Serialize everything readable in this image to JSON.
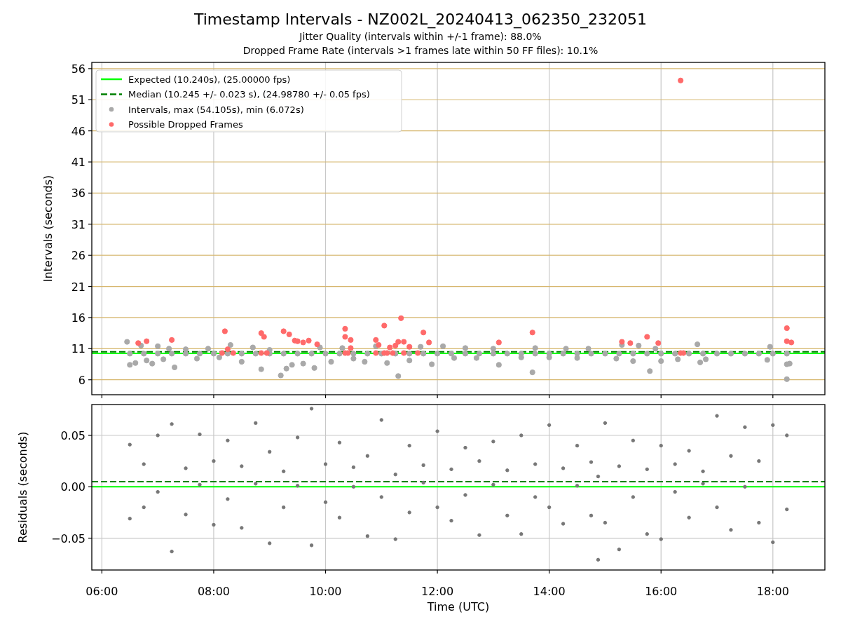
{
  "figure": {
    "title": "Timestamp Intervals - NZ002L_20240413_062350_232051",
    "subtitles": [
      "Jitter Quality (intervals within +/-1 frame): 88.0%",
      "Dropped Frame Rate (intervals >1 frames late within 50 FF files): 10.1%"
    ]
  },
  "panels": [
    {
      "chart_data": {
        "type": "scatter",
        "ylabel": "Intervals (seconds)",
        "xlim": [
          5.82,
          18.93
        ],
        "ylim": [
          3.6,
          57
        ],
        "legend": true,
        "grid": true,
        "yticks": [
          {
            "value": 6,
            "label": "6"
          },
          {
            "value": 11,
            "label": "11"
          },
          {
            "value": 16,
            "label": "16"
          },
          {
            "value": 21,
            "label": "21"
          },
          {
            "value": 26,
            "label": "26"
          },
          {
            "value": 31,
            "label": "31"
          },
          {
            "value": 36,
            "label": "36"
          },
          {
            "value": 41,
            "label": "41"
          },
          {
            "value": 46,
            "label": "46"
          },
          {
            "value": 51,
            "label": "51"
          },
          {
            "value": 56,
            "label": "56"
          }
        ],
        "series": [
          {
            "type": "line",
            "name": "Expected (10.240s), (25.00000 fps)",
            "color": "#00ff00",
            "x": [
              5.82,
              18.93
            ],
            "values": [
              10.24,
              10.24
            ]
          },
          {
            "type": "line",
            "name": "Median (10.245 +/- 0.023 s), (24.98780 +/- 0.05 fps)",
            "color": "#008000",
            "line_style": "dashed",
            "x": [
              5.82,
              18.93
            ],
            "values": [
              10.5,
              10.5
            ]
          },
          {
            "type": "scatter",
            "name": "Intervals, max (54.105s), min (6.072s)",
            "color": "#a9a9a9",
            "x": [
              6.5,
              6.75,
              7.0,
              7.25,
              7.5,
              7.75,
              8.0,
              8.25,
              8.5,
              8.75,
              9.0,
              9.25,
              9.5,
              9.75,
              10.0,
              10.25,
              10.5,
              10.75,
              11.0,
              11.25,
              11.5,
              11.75,
              12.0,
              12.25,
              12.5,
              12.75,
              13.0,
              13.25,
              13.5,
              13.75,
              14.0,
              14.25,
              14.5,
              14.75,
              15.0,
              15.25,
              15.5,
              15.75,
              16.0,
              16.25,
              16.5,
              16.75,
              17.0,
              17.25,
              17.5,
              17.75,
              18.0,
              18.25,
              6.45,
              6.5,
              6.6,
              6.7,
              6.8,
              6.9,
              7.0,
              7.1,
              7.2,
              7.3,
              7.5,
              7.7,
              7.9,
              8.1,
              8.3,
              8.5,
              8.7,
              8.85,
              9.0,
              9.2,
              9.3,
              9.4,
              9.6,
              9.8,
              9.9,
              10.1,
              10.3,
              10.5,
              10.7,
              10.9,
              11.1,
              11.3,
              11.5,
              11.7,
              11.9,
              12.1,
              12.3,
              12.5,
              12.7,
              13.0,
              13.1,
              13.5,
              13.7,
              13.75,
              14.0,
              14.3,
              14.5,
              14.7,
              15.2,
              15.3,
              15.5,
              15.6,
              15.8,
              15.9,
              16.0,
              16.3,
              16.65,
              16.7,
              16.8,
              17.9,
              17.95,
              18.25,
              18.25,
              18.3
            ],
            "values": [
              10.2,
              10.2,
              10.2,
              10.2,
              10.2,
              10.2,
              10.2,
              10.2,
              10.2,
              10.2,
              10.2,
              10.2,
              10.2,
              10.2,
              10.2,
              10.2,
              10.2,
              10.2,
              10.2,
              10.2,
              10.2,
              10.2,
              10.2,
              10.2,
              10.2,
              10.2,
              10.2,
              10.2,
              10.2,
              10.2,
              10.2,
              10.2,
              10.2,
              10.2,
              10.2,
              10.2,
              10.2,
              10.2,
              10.2,
              10.2,
              10.2,
              10.2,
              10.2,
              10.2,
              10.2,
              10.2,
              10.2,
              10.2,
              12.1,
              8.4,
              8.7,
              11.5,
              9.1,
              8.6,
              11.4,
              9.3,
              11.0,
              8.0,
              10.9,
              9.4,
              11.0,
              9.6,
              11.6,
              8.9,
              11.2,
              7.7,
              10.8,
              6.7,
              7.8,
              8.4,
              8.6,
              7.9,
              11.2,
              8.9,
              11.1,
              9.4,
              8.9,
              11.4,
              8.7,
              6.6,
              9.1,
              11.3,
              8.5,
              11.4,
              9.5,
              11.1,
              9.5,
              11.0,
              8.4,
              9.6,
              7.2,
              11.1,
              9.6,
              11.0,
              9.5,
              11.0,
              9.4,
              11.6,
              9.0,
              11.5,
              7.4,
              11.0,
              9.0,
              9.3,
              11.7,
              8.8,
              9.3,
              9.2,
              11.3,
              6.1,
              8.5,
              8.6
            ]
          },
          {
            "type": "scatter",
            "name": "Possible Dropped Frames",
            "color": "#ff6a6a",
            "x": [
              6.65,
              6.8,
              7.25,
              8.2,
              8.25,
              8.85,
              8.9,
              9.25,
              9.35,
              9.45,
              9.5,
              9.6,
              9.7,
              9.85,
              10.35,
              10.35,
              10.45,
              10.45,
              10.9,
              10.95,
              11.05,
              11.15,
              11.25,
              11.3,
              11.35,
              11.4,
              11.5,
              11.75,
              11.85,
              13.1,
              13.7,
              15.3,
              15.45,
              15.75,
              15.95,
              16.35,
              18.25,
              18.25,
              18.33,
              8.15,
              8.35,
              8.85,
              8.95,
              10.35,
              10.4,
              10.9,
              11.05,
              11.1,
              11.2,
              11.4,
              11.65,
              16.35,
              16.4
            ],
            "values": [
              11.9,
              12.2,
              12.4,
              13.8,
              10.9,
              13.5,
              12.9,
              13.8,
              13.3,
              12.3,
              12.2,
              12.0,
              12.3,
              11.7,
              14.2,
              12.9,
              12.4,
              11.1,
              12.4,
              11.6,
              14.7,
              11.2,
              11.5,
              12.1,
              15.9,
              12.1,
              11.3,
              13.6,
              12.0,
              12.0,
              13.6,
              12.1,
              11.9,
              12.9,
              11.9,
              54.1,
              14.3,
              12.2,
              12.0,
              10.3,
              10.3,
              10.3,
              10.3,
              10.3,
              10.3,
              10.3,
              10.3,
              10.3,
              10.3,
              10.3,
              10.3,
              10.3,
              10.3
            ]
          }
        ]
      }
    },
    {
      "chart_data": {
        "type": "scatter",
        "xlabel": "Time (UTC)",
        "ylabel": "Residuals (seconds)",
        "xlim": [
          5.82,
          18.93
        ],
        "ylim": [
          -0.081,
          0.08
        ],
        "legend": false,
        "grid": true,
        "xticks": [
          {
            "value": 6,
            "label": "06:00"
          },
          {
            "value": 8,
            "label": "08:00"
          },
          {
            "value": 10,
            "label": "10:00"
          },
          {
            "value": 12,
            "label": "12:00"
          },
          {
            "value": 14,
            "label": "14:00"
          },
          {
            "value": 16,
            "label": "16:00"
          },
          {
            "value": 18,
            "label": "18:00"
          }
        ],
        "yticks": [
          {
            "value": -0.05,
            "label": "−0.05"
          },
          {
            "value": 0,
            "label": "0.00"
          },
          {
            "value": 0.05,
            "label": "0.05"
          }
        ],
        "series": [
          {
            "type": "line",
            "color": "#00ff00",
            "x": [
              5.82,
              18.93
            ],
            "values": [
              0,
              0
            ]
          },
          {
            "type": "line",
            "color": "#008000",
            "line_style": "dashed",
            "x": [
              5.82,
              18.93
            ],
            "values": [
              0.005,
              0.005
            ]
          },
          {
            "type": "scatter",
            "color": "#777777",
            "x": [
              6.5,
              6.5,
              6.75,
              6.75,
              7.0,
              7.0,
              7.25,
              7.25,
              7.5,
              7.5,
              7.75,
              7.75,
              8.0,
              8.0,
              8.25,
              8.25,
              8.5,
              8.5,
              8.75,
              8.75,
              9.0,
              9.0,
              9.25,
              9.25,
              9.5,
              9.5,
              9.75,
              9.75,
              10.0,
              10.0,
              10.25,
              10.25,
              10.5,
              10.5,
              10.75,
              10.75,
              11.0,
              11.0,
              11.25,
              11.25,
              11.5,
              11.5,
              11.75,
              11.75,
              12.0,
              12.0,
              12.25,
              12.25,
              12.5,
              12.5,
              12.75,
              12.75,
              13.0,
              13.0,
              13.25,
              13.25,
              13.5,
              13.5,
              13.75,
              13.75,
              14.0,
              14.0,
              14.25,
              14.25,
              14.5,
              14.5,
              14.75,
              14.75,
              14.875,
              14.875,
              15.0,
              15.0,
              15.25,
              15.25,
              15.5,
              15.5,
              15.75,
              15.75,
              16.0,
              16.0,
              16.25,
              16.25,
              16.5,
              16.5,
              16.75,
              16.75,
              17.0,
              17.0,
              17.25,
              17.25,
              17.5,
              17.5,
              17.75,
              17.75,
              18.0,
              18.0,
              18.25,
              18.25
            ],
            "values": [
              0.041,
              -0.031,
              0.022,
              -0.02,
              0.05,
              -0.005,
              0.061,
              -0.063,
              0.018,
              -0.027,
              0.051,
              0.002,
              0.025,
              -0.037,
              0.045,
              -0.012,
              0.02,
              -0.04,
              0.062,
              0.003,
              0.034,
              -0.055,
              0.015,
              -0.02,
              0.048,
              0.001,
              0.076,
              -0.057,
              0.022,
              -0.015,
              0.043,
              -0.03,
              0.019,
              0.0,
              0.03,
              -0.048,
              0.065,
              -0.01,
              0.012,
              -0.051,
              0.04,
              -0.025,
              0.021,
              0.004,
              0.054,
              -0.02,
              0.017,
              -0.033,
              0.038,
              -0.008,
              0.025,
              -0.047,
              0.044,
              0.002,
              0.016,
              -0.028,
              0.05,
              -0.046,
              0.022,
              -0.01,
              0.06,
              -0.02,
              0.018,
              -0.036,
              0.04,
              0.001,
              0.024,
              -0.028,
              -0.071,
              0.01,
              0.062,
              -0.035,
              0.02,
              -0.061,
              0.045,
              -0.01,
              0.017,
              -0.046,
              0.04,
              -0.051,
              0.022,
              -0.005,
              0.035,
              -0.03,
              0.015,
              0.003,
              0.069,
              -0.02,
              0.03,
              -0.042,
              0.058,
              0.0,
              0.025,
              -0.035,
              0.06,
              -0.054,
              0.05,
              -0.022
            ]
          }
        ]
      }
    }
  ]
}
